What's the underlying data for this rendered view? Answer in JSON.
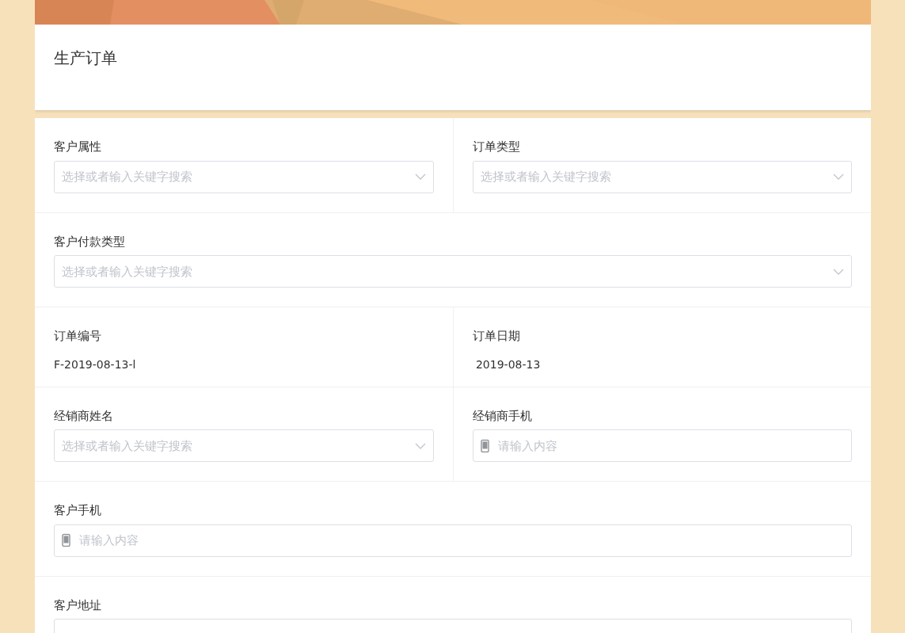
{
  "form_title": "生产订单",
  "rows": [
    {
      "fields": [
        {
          "label": "客户属性",
          "kind": "select",
          "placeholder": "选择或者输入关键字搜索"
        },
        {
          "label": "订单类型",
          "kind": "select",
          "placeholder": "选择或者输入关键字搜索"
        }
      ]
    },
    {
      "fields": [
        {
          "label": "客户付款类型",
          "kind": "select",
          "placeholder": "选择或者输入关键字搜索"
        }
      ]
    },
    {
      "fields": [
        {
          "label": "订单编号",
          "kind": "readonly",
          "value": "F-2019-08-13-l"
        },
        {
          "label": "订单日期",
          "kind": "readonly",
          "value": " 2019-08-13"
        }
      ]
    },
    {
      "fields": [
        {
          "label": "经销商姓名",
          "kind": "select",
          "placeholder": "选择或者输入关键字搜索"
        },
        {
          "label": "经销商手机",
          "kind": "phone",
          "placeholder": "请输入内容"
        }
      ]
    },
    {
      "fields": [
        {
          "label": "客户手机",
          "kind": "phone",
          "placeholder": "请输入内容"
        }
      ]
    },
    {
      "fields": [
        {
          "label": "客户地址",
          "kind": "input"
        }
      ]
    }
  ]
}
